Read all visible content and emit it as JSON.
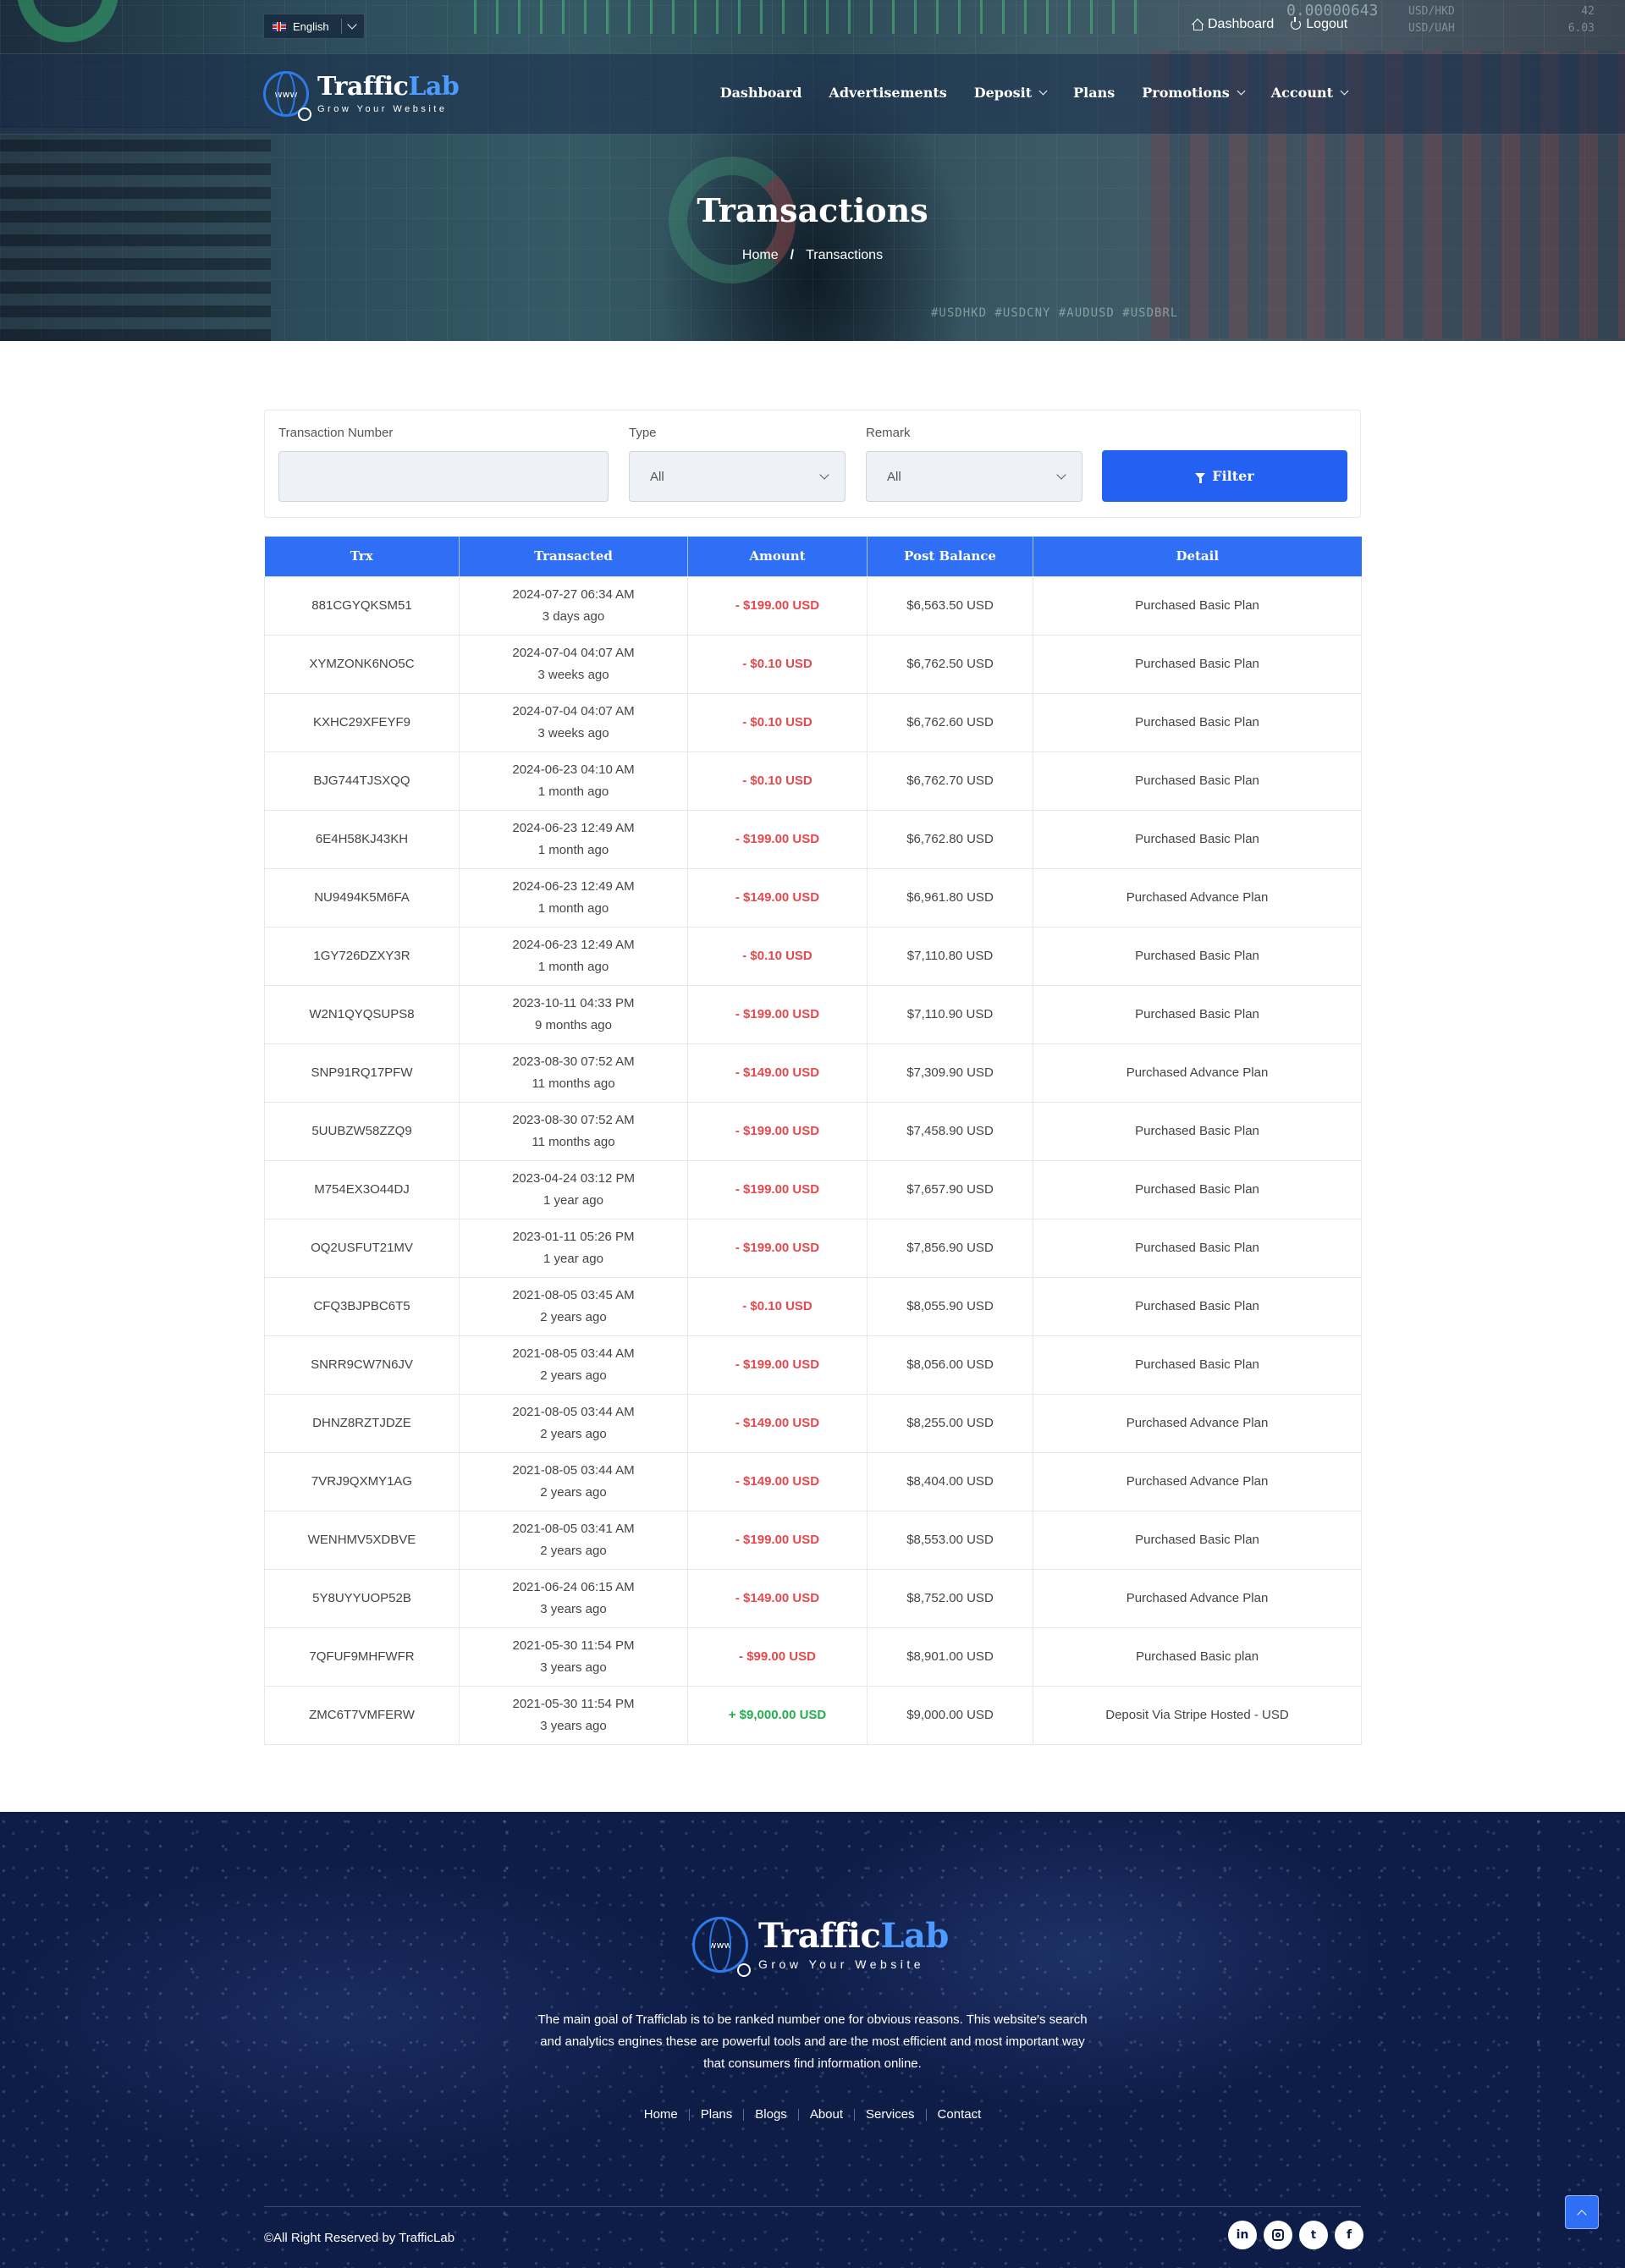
{
  "topbar": {
    "language": "English",
    "links": [
      {
        "label": "Dashboard",
        "icon": "home-icon"
      },
      {
        "label": "Logout",
        "icon": "logout-icon"
      }
    ]
  },
  "hero_decor": {
    "price": "0.00000643",
    "quotes": [
      {
        "pair": "USD/HKD",
        "value": "42"
      },
      {
        "pair": "USD/UAH",
        "value": "6.03"
      }
    ],
    "ticker": "#USDHKD        #USDCNY   #AUDUSD   #USDBRL"
  },
  "brand": {
    "name_main": "Traffic",
    "name_accent": "Lab",
    "tagline": "Grow Your Website",
    "globe_text": "www",
    "accent_color": "#2d7be8"
  },
  "nav": {
    "items": [
      {
        "label": "Dashboard",
        "dropdown": false
      },
      {
        "label": "Advertisements",
        "dropdown": false
      },
      {
        "label": "Deposit",
        "dropdown": true
      },
      {
        "label": "Plans",
        "dropdown": false
      },
      {
        "label": "Promotions",
        "dropdown": true
      },
      {
        "label": "Account",
        "dropdown": true
      }
    ]
  },
  "page": {
    "title": "Transactions",
    "breadcrumb": {
      "home": "Home",
      "separator": "/",
      "current": "Transactions"
    }
  },
  "filter": {
    "trx_label": "Transaction Number",
    "trx_value": "",
    "type_label": "Type",
    "type_value": "All",
    "remark_label": "Remark",
    "remark_value": "All",
    "button_label": "Filter",
    "button_color": "#2461f2"
  },
  "table": {
    "header_color": "#2f6ff5",
    "negative_color": "#e5484d",
    "positive_color": "#22b04b",
    "columns": [
      "Trx",
      "Transacted",
      "Amount",
      "Post Balance",
      "Detail"
    ],
    "rows": [
      {
        "trx": "881CGYQKSM51",
        "date": "2024-07-27 06:34 AM",
        "ago": "3 days ago",
        "amount": "- $199.00 USD",
        "sign": "neg",
        "balance": "$6,563.50 USD",
        "detail": "Purchased Basic Plan"
      },
      {
        "trx": "XYMZONK6NO5C",
        "date": "2024-07-04 04:07 AM",
        "ago": "3 weeks ago",
        "amount": "- $0.10 USD",
        "sign": "neg",
        "balance": "$6,762.50 USD",
        "detail": "Purchased Basic Plan"
      },
      {
        "trx": "KXHC29XFEYF9",
        "date": "2024-07-04 04:07 AM",
        "ago": "3 weeks ago",
        "amount": "- $0.10 USD",
        "sign": "neg",
        "balance": "$6,762.60 USD",
        "detail": "Purchased Basic Plan"
      },
      {
        "trx": "BJG744TJSXQQ",
        "date": "2024-06-23 04:10 AM",
        "ago": "1 month ago",
        "amount": "- $0.10 USD",
        "sign": "neg",
        "balance": "$6,762.70 USD",
        "detail": "Purchased Basic Plan"
      },
      {
        "trx": "6E4H58KJ43KH",
        "date": "2024-06-23 12:49 AM",
        "ago": "1 month ago",
        "amount": "- $199.00 USD",
        "sign": "neg",
        "balance": "$6,762.80 USD",
        "detail": "Purchased Basic Plan"
      },
      {
        "trx": "NU9494K5M6FA",
        "date": "2024-06-23 12:49 AM",
        "ago": "1 month ago",
        "amount": "- $149.00 USD",
        "sign": "neg",
        "balance": "$6,961.80 USD",
        "detail": "Purchased Advance Plan"
      },
      {
        "trx": "1GY726DZXY3R",
        "date": "2024-06-23 12:49 AM",
        "ago": "1 month ago",
        "amount": "- $0.10 USD",
        "sign": "neg",
        "balance": "$7,110.80 USD",
        "detail": "Purchased Basic Plan"
      },
      {
        "trx": "W2N1QYQSUPS8",
        "date": "2023-10-11 04:33 PM",
        "ago": "9 months ago",
        "amount": "- $199.00 USD",
        "sign": "neg",
        "balance": "$7,110.90 USD",
        "detail": "Purchased Basic Plan"
      },
      {
        "trx": "SNP91RQ17PFW",
        "date": "2023-08-30 07:52 AM",
        "ago": "11 months ago",
        "amount": "- $149.00 USD",
        "sign": "neg",
        "balance": "$7,309.90 USD",
        "detail": "Purchased Advance Plan"
      },
      {
        "trx": "5UUBZW58ZZQ9",
        "date": "2023-08-30 07:52 AM",
        "ago": "11 months ago",
        "amount": "- $199.00 USD",
        "sign": "neg",
        "balance": "$7,458.90 USD",
        "detail": "Purchased Basic Plan"
      },
      {
        "trx": "M754EX3O44DJ",
        "date": "2023-04-24 03:12 PM",
        "ago": "1 year ago",
        "amount": "- $199.00 USD",
        "sign": "neg",
        "balance": "$7,657.90 USD",
        "detail": "Purchased Basic Plan"
      },
      {
        "trx": "OQ2USFUT21MV",
        "date": "2023-01-11 05:26 PM",
        "ago": "1 year ago",
        "amount": "- $199.00 USD",
        "sign": "neg",
        "balance": "$7,856.90 USD",
        "detail": "Purchased Basic Plan"
      },
      {
        "trx": "CFQ3BJPBC6T5",
        "date": "2021-08-05 03:45 AM",
        "ago": "2 years ago",
        "amount": "- $0.10 USD",
        "sign": "neg",
        "balance": "$8,055.90 USD",
        "detail": "Purchased Basic Plan"
      },
      {
        "trx": "SNRR9CW7N6JV",
        "date": "2021-08-05 03:44 AM",
        "ago": "2 years ago",
        "amount": "- $199.00 USD",
        "sign": "neg",
        "balance": "$8,056.00 USD",
        "detail": "Purchased Basic Plan"
      },
      {
        "trx": "DHNZ8RZTJDZE",
        "date": "2021-08-05 03:44 AM",
        "ago": "2 years ago",
        "amount": "- $149.00 USD",
        "sign": "neg",
        "balance": "$8,255.00 USD",
        "detail": "Purchased Advance Plan"
      },
      {
        "trx": "7VRJ9QXMY1AG",
        "date": "2021-08-05 03:44 AM",
        "ago": "2 years ago",
        "amount": "- $149.00 USD",
        "sign": "neg",
        "balance": "$8,404.00 USD",
        "detail": "Purchased Advance Plan"
      },
      {
        "trx": "WENHMV5XDBVE",
        "date": "2021-08-05 03:41 AM",
        "ago": "2 years ago",
        "amount": "- $199.00 USD",
        "sign": "neg",
        "balance": "$8,553.00 USD",
        "detail": "Purchased Basic Plan"
      },
      {
        "trx": "5Y8UYYUOP52B",
        "date": "2021-06-24 06:15 AM",
        "ago": "3 years ago",
        "amount": "- $149.00 USD",
        "sign": "neg",
        "balance": "$8,752.00 USD",
        "detail": "Purchased Advance Plan"
      },
      {
        "trx": "7QFUF9MHFWFR",
        "date": "2021-05-30 11:54 PM",
        "ago": "3 years ago",
        "amount": "- $99.00 USD",
        "sign": "neg",
        "balance": "$8,901.00 USD",
        "detail": "Purchased Basic plan"
      },
      {
        "trx": "ZMC6T7VMFERW",
        "date": "2021-05-30 11:54 PM",
        "ago": "3 years ago",
        "amount": "+ $9,000.00 USD",
        "sign": "pos",
        "balance": "$9,000.00 USD",
        "detail": "Deposit Via Stripe Hosted - USD"
      }
    ]
  },
  "footer": {
    "about": "The main goal of Trafficlab is to be ranked number one for obvious reasons. This website's search and analytics engines these are powerful tools and are the most efficient and most important way that consumers find information online.",
    "links": [
      "Home",
      "Plans",
      "Blogs",
      "About",
      "Services",
      "Contact"
    ],
    "copyright": "©All Right Reserved by TrafficLab",
    "social": [
      {
        "name": "linkedin-icon",
        "glyph": "in"
      },
      {
        "name": "instagram-icon",
        "glyph": ""
      },
      {
        "name": "twitter-icon",
        "glyph": "🐦"
      },
      {
        "name": "facebook-icon",
        "glyph": "f"
      }
    ]
  }
}
